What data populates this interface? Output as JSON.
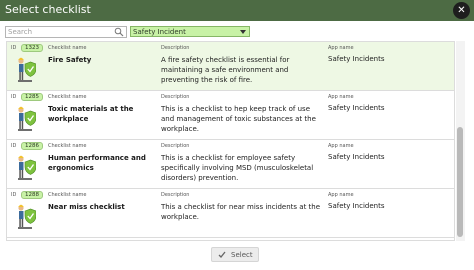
{
  "dialog": {
    "title": "Select checklist",
    "close_glyph": "✕"
  },
  "search": {
    "placeholder": "Search",
    "value": ""
  },
  "filter": {
    "selected": "Safety Incident"
  },
  "columns": {
    "id": "ID",
    "name": "Checklist name",
    "description": "Description",
    "app": "App name"
  },
  "rows": [
    {
      "id": "1323",
      "name": "Fire Safety",
      "description": "A fire safety checklist is essential for maintaining a safe environment and preventing the risk of fire.",
      "app": "Safety Incidents",
      "selected": true
    },
    {
      "id": "1285",
      "name": "Toxic materials at the workplace",
      "description": "This is a checklist to hep keep track of use and management of toxic substances at the workplace.",
      "app": "Safety Incidents",
      "selected": false
    },
    {
      "id": "1286",
      "name": "Human performance and ergonomics",
      "description": "This is a checklist for employee safety specifically involving MSD (musculoskeletal disorders) prevention.",
      "app": "Safety Incidents",
      "selected": false
    },
    {
      "id": "1288",
      "name": "Near miss checklist",
      "description": "This a checklist for near miss incidents at the workplace.",
      "app": "Safety Incidents",
      "selected": false
    }
  ],
  "footer": {
    "select_label": "Select"
  },
  "colors": {
    "header": "#4d6b44",
    "badge": "#c8f2a6",
    "selected_row": "#eef8e4"
  },
  "icons": {
    "close": "close-icon",
    "search": "search-icon",
    "dropdown": "chevron-down-icon",
    "row_avatar": "safety-worker-shield-icon",
    "select": "check-icon"
  }
}
